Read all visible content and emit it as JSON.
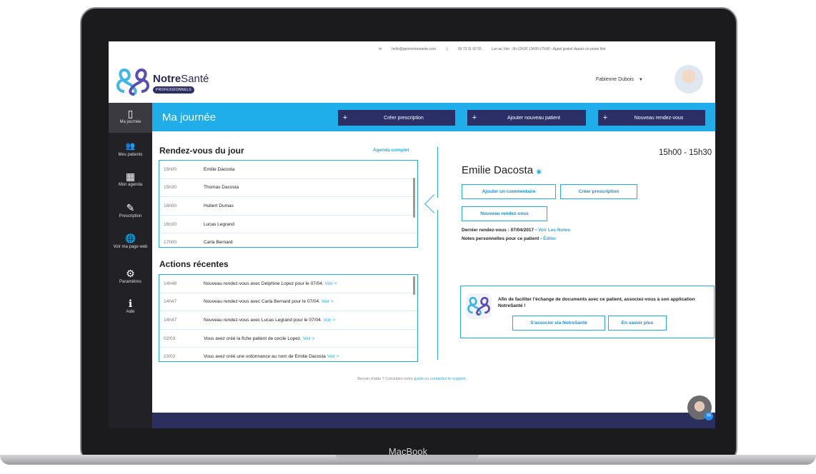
{
  "device_label": "MacBook",
  "topbar": {
    "email": "hello@gerernotresante.com",
    "phone": "09 73 11 92 55",
    "hours": "Lun au Ven : 9h-12h30 13h30-17h30 - Appel gratuit depuis un poste fixe"
  },
  "logo": {
    "name_bold": "Notre",
    "name_light": "Santé",
    "badge": "PROFESSIONNELS"
  },
  "user": {
    "name": "Fabienne Dubois",
    "dropdown_icon": "caret-down"
  },
  "sidebar": {
    "items": [
      {
        "icon": "book",
        "glyph": "▯",
        "label": "Ma journée",
        "active": true
      },
      {
        "icon": "users",
        "glyph": "👥",
        "label": "Mes patients"
      },
      {
        "icon": "calendar",
        "glyph": "▦",
        "label": "Mon agenda"
      },
      {
        "icon": "edit",
        "glyph": "✎",
        "label": "Prescription"
      },
      {
        "icon": "globe",
        "glyph": "🌐",
        "label": "Voir ma page web"
      },
      {
        "icon": "gear",
        "glyph": "⚙",
        "label": "Paramètres"
      },
      {
        "icon": "info",
        "glyph": "ℹ",
        "label": "Aide"
      }
    ]
  },
  "header": {
    "title": "Ma journée",
    "buttons": [
      "Créer prescription",
      "Ajouter nouveau patient",
      "Nouveau rendez-vous"
    ]
  },
  "appointments": {
    "title": "Rendez-vous du jour",
    "link": "Agenda complet",
    "rows": [
      {
        "time": "15h00",
        "name": "Emilie Dacosta"
      },
      {
        "time": "15h30",
        "name": "Thomas Dacosta"
      },
      {
        "time": "16h00",
        "name": "Hubert Dumas"
      },
      {
        "time": "16h30",
        "name": "Lucas Legrand"
      },
      {
        "time": "17h00",
        "name": "Carla Bernard"
      }
    ]
  },
  "actions": {
    "title": "Actions récentes",
    "rows": [
      {
        "time": "14h48",
        "text": "Nouveau rendez-vous avec Delphine Lopez pour le 07/04.",
        "link": "Voir >"
      },
      {
        "time": "14h47",
        "text": "Nouveau rendez-vous avec Carla Bernard pour le 07/04.",
        "link": "Voir >"
      },
      {
        "time": "14h47",
        "text": "Nouveau rendez-vous avec Lucas Legrand pour le 07/04.",
        "link": "Voir >"
      },
      {
        "time": "02/03",
        "text": "Vous avez créé la fiche patient de cecile Lopez.",
        "link": "Voir >"
      },
      {
        "time": "23/02",
        "text": "Vous avez créé une ordonnance au nom de Emilie Dacosta",
        "link": "Voir >"
      }
    ]
  },
  "detail": {
    "slot": "15h00 - 15h30",
    "patient": "Emilie Dacosta",
    "btn_comment": "Ajouter un commentaire",
    "btn_prescription": "Créer prescription",
    "btn_rdv": "Nouveau rendez-vous",
    "last_rdv_label": "Dernier rendez-vous : 07/04/2017 -",
    "last_rdv_link": "Voir Les Notes",
    "notes_label": "Notes personnelles pour ce patient -",
    "notes_link": "Éditer"
  },
  "card": {
    "message": "Afin de faciliter l'échange de documents avec ce patient, associez-vous à son application NotreSanté !",
    "btn_associate": "S'associer via NotreSanté",
    "btn_more": "En savoir plus"
  },
  "help": {
    "prefix": "Besoin d'aide ? Consultez notre",
    "guide": "guide",
    "middle": "ou",
    "support": "contactez le support",
    "suffix": "."
  }
}
